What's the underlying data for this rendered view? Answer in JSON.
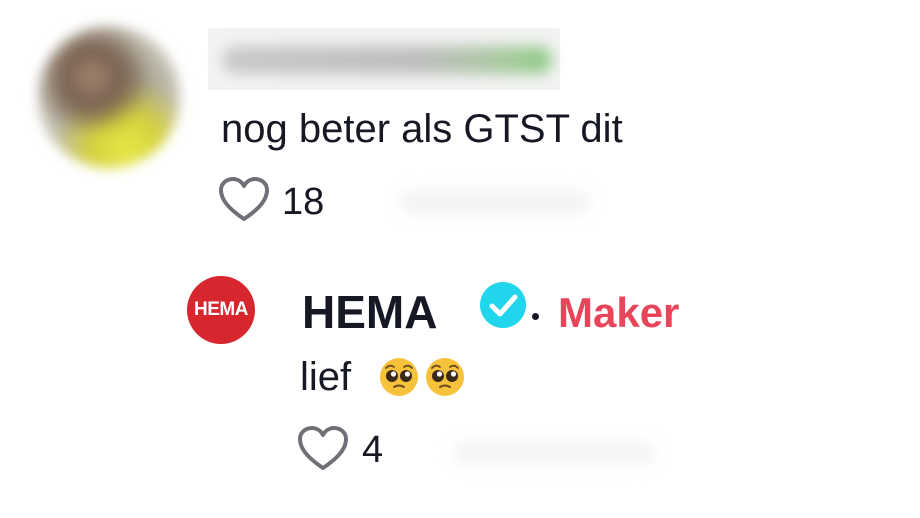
{
  "comment": {
    "text": "nog beter als GTST dit",
    "likes": "18",
    "like_icon": "heart-outline-icon"
  },
  "reply": {
    "logo_text": "HEMA",
    "author": "HEMA",
    "badge_icon": "verified-check-icon",
    "badge_color": "#20d5ec",
    "creator_label": "Maker",
    "creator_color": "#e8445a",
    "text": "lief",
    "emoji_icon": "pleading-face-emoji",
    "likes": "4",
    "like_icon": "heart-outline-icon"
  }
}
